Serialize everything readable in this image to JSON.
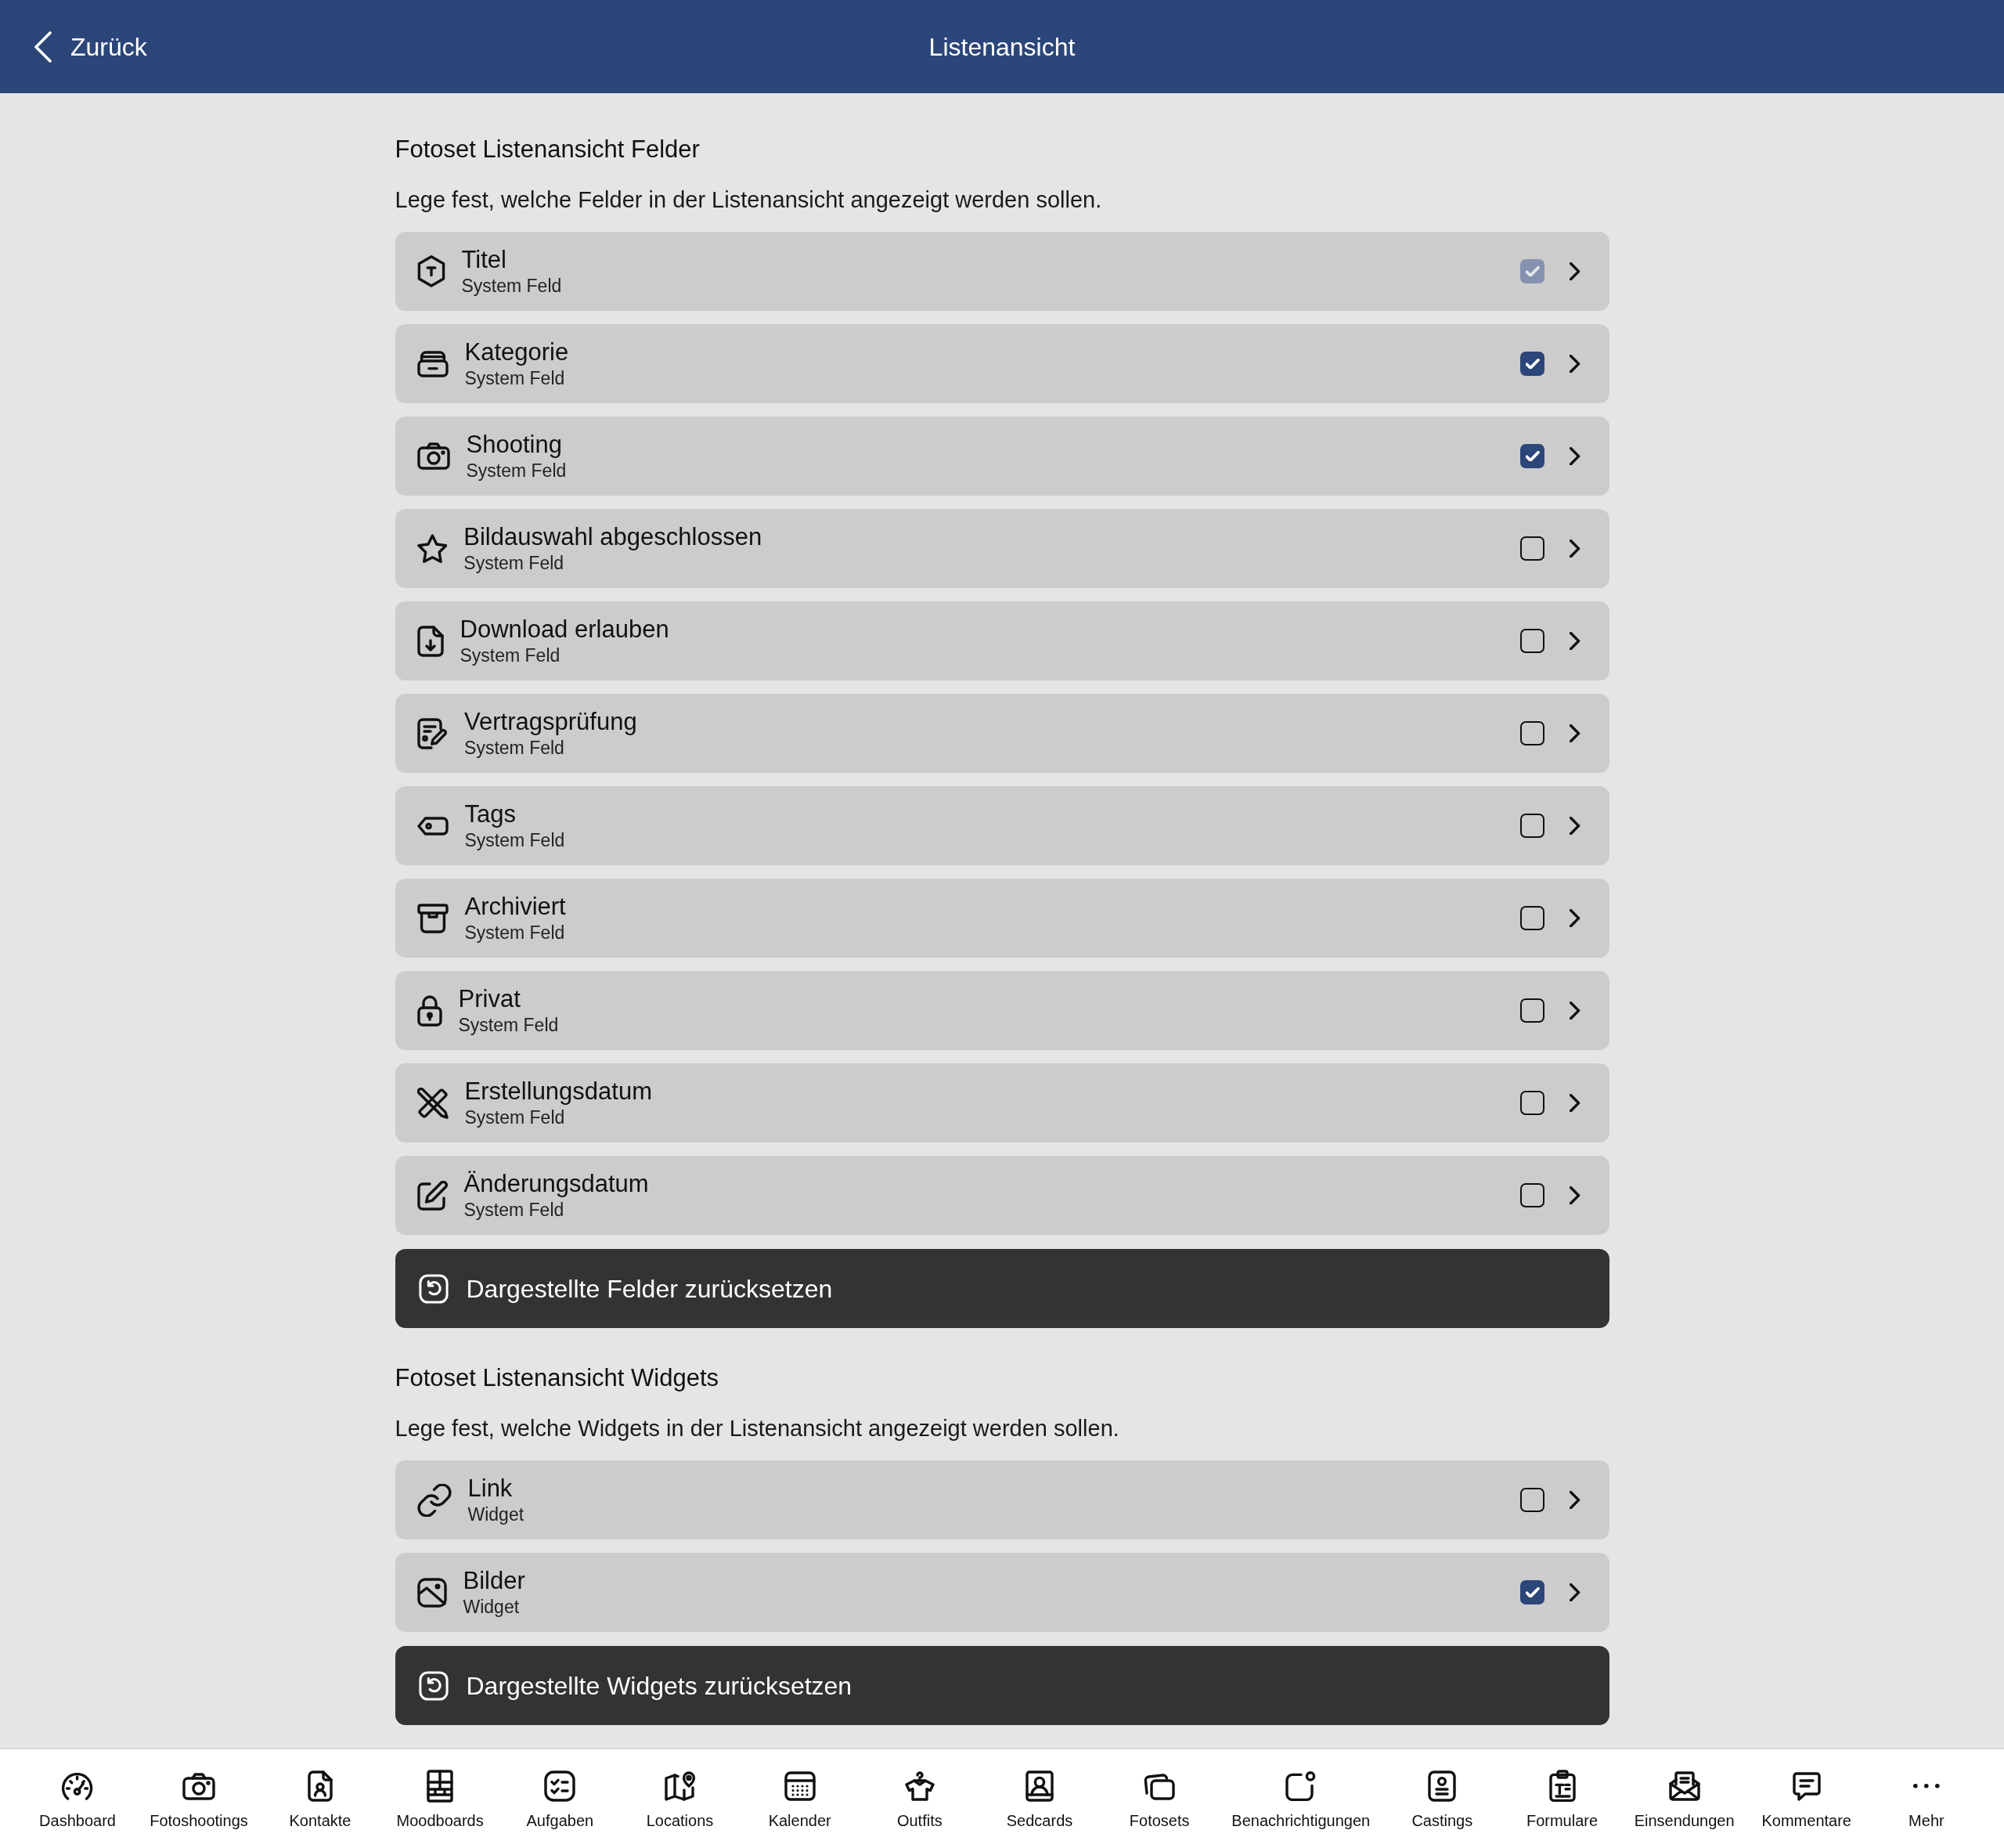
{
  "header": {
    "back_label": "Zurück",
    "title": "Listenansicht"
  },
  "sections": [
    {
      "title": "Fotoset Listenansicht Felder",
      "description": "Lege fest, welche Felder in der Listenansicht angezeigt werden sollen.",
      "items": [
        {
          "title": "Titel",
          "subtitle": "System Feld",
          "checked": true,
          "disabled": true
        },
        {
          "title": "Kategorie",
          "subtitle": "System Feld",
          "checked": true,
          "disabled": false
        },
        {
          "title": "Shooting",
          "subtitle": "System Feld",
          "checked": true,
          "disabled": false
        },
        {
          "title": "Bildauswahl abgeschlossen",
          "subtitle": "System Feld",
          "checked": false,
          "disabled": false
        },
        {
          "title": "Download erlauben",
          "subtitle": "System Feld",
          "checked": false,
          "disabled": false
        },
        {
          "title": "Vertragsprüfung",
          "subtitle": "System Feld",
          "checked": false,
          "disabled": false
        },
        {
          "title": "Tags",
          "subtitle": "System Feld",
          "checked": false,
          "disabled": false
        },
        {
          "title": "Archiviert",
          "subtitle": "System Feld",
          "checked": false,
          "disabled": false
        },
        {
          "title": "Privat",
          "subtitle": "System Feld",
          "checked": false,
          "disabled": false
        },
        {
          "title": "Erstellungsdatum",
          "subtitle": "System Feld",
          "checked": false,
          "disabled": false
        },
        {
          "title": "Änderungsdatum",
          "subtitle": "System Feld",
          "checked": false,
          "disabled": false
        }
      ],
      "reset_button": "Dargestellte Felder zurücksetzen"
    },
    {
      "title": "Fotoset Listenansicht Widgets",
      "description": "Lege fest, welche Widgets in der Listenansicht angezeigt werden sollen.",
      "items": [
        {
          "title": "Link",
          "subtitle": "Widget",
          "checked": false,
          "disabled": false
        },
        {
          "title": "Bilder",
          "subtitle": "Widget",
          "checked": true,
          "disabled": false
        }
      ],
      "reset_button": "Dargestellte Widgets zurücksetzen"
    }
  ],
  "tab_bar": {
    "items": [
      {
        "label": "Dashboard",
        "selected": false
      },
      {
        "label": "Fotoshootings",
        "selected": false
      },
      {
        "label": "Kontakte",
        "selected": false
      },
      {
        "label": "Moodboards",
        "selected": false
      },
      {
        "label": "Aufgaben",
        "selected": false
      },
      {
        "label": "Locations",
        "selected": false
      },
      {
        "label": "Kalender",
        "selected": false
      },
      {
        "label": "Outfits",
        "selected": false
      },
      {
        "label": "Sedcards",
        "selected": false
      },
      {
        "label": "Fotosets",
        "selected": false
      },
      {
        "label": "Benachrichtigungen",
        "selected": false
      },
      {
        "label": "Castings",
        "selected": false
      },
      {
        "label": "Formulare",
        "selected": false
      },
      {
        "label": "Einsendungen",
        "selected": false
      },
      {
        "label": "Kommentare",
        "selected": false
      },
      {
        "label": "Mehr",
        "selected": false
      }
    ]
  }
}
